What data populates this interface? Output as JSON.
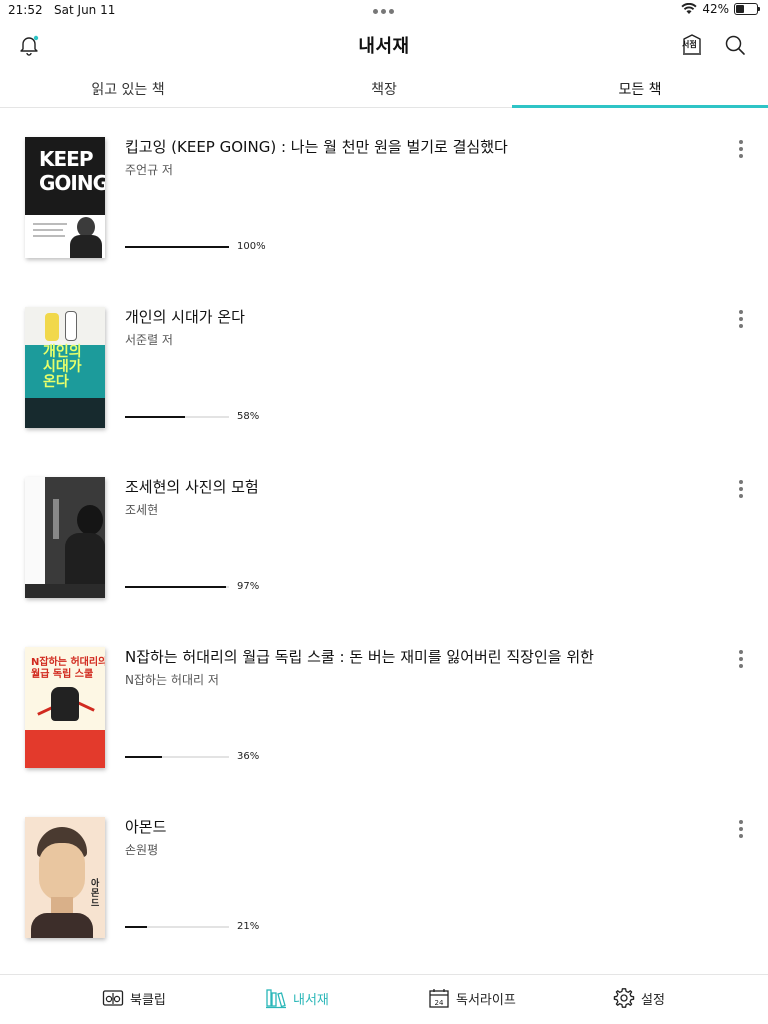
{
  "status_bar": {
    "time": "21:52",
    "date": "Sat Jun 11",
    "battery_percent_label": "42%",
    "battery_level": 0.42
  },
  "header": {
    "title": "내서재",
    "store_label": "서점",
    "icons": [
      "bell-icon",
      "store-icon",
      "search-icon"
    ],
    "notification_dot_color": "#2ec4c6"
  },
  "tabs": [
    {
      "label": "읽고 있는 책",
      "active": false
    },
    {
      "label": "책장",
      "active": false
    },
    {
      "label": "모든 책",
      "active": true
    }
  ],
  "accent_color": "#2ec4c6",
  "books": [
    {
      "title": "킵고잉 (KEEP GOING) : 나는 월 천만 원을 벌기로 결심했다",
      "author": "주언규 저",
      "progress_label": "100%",
      "progress": 1.0,
      "cover_text": [
        "KEEP",
        "GOING"
      ]
    },
    {
      "title": "개인의 시대가 온다",
      "author": "서준렬 저",
      "progress_label": "58%",
      "progress": 0.58,
      "cover_text": [
        "개인의",
        "시대가",
        "온다"
      ]
    },
    {
      "title": "조세현의 사진의 모험",
      "author": "조세현",
      "progress_label": "97%",
      "progress": 0.97,
      "cover_text": []
    },
    {
      "title": "N잡하는 허대리의 월급 독립 스쿨 : 돈 버는 재미를 잃어버린 직장인을 위한",
      "author": "N잡하는 허대리 저",
      "progress_label": "36%",
      "progress": 0.36,
      "cover_text": [
        "N잡하는 허대리의",
        "월급 독립 스쿨"
      ]
    },
    {
      "title": "아몬드",
      "author": "손원평",
      "progress_label": "21%",
      "progress": 0.21,
      "cover_text": [
        "아몬드"
      ]
    }
  ],
  "bottom_nav": [
    {
      "label": "북클립",
      "icon": "bookclip-icon",
      "active": false
    },
    {
      "label": "내서재",
      "icon": "bookshelf-icon",
      "active": true
    },
    {
      "label": "독서라이프",
      "icon": "calendar-icon",
      "active": false,
      "icon_text": "24"
    },
    {
      "label": "설정",
      "icon": "gear-icon",
      "active": false
    }
  ]
}
